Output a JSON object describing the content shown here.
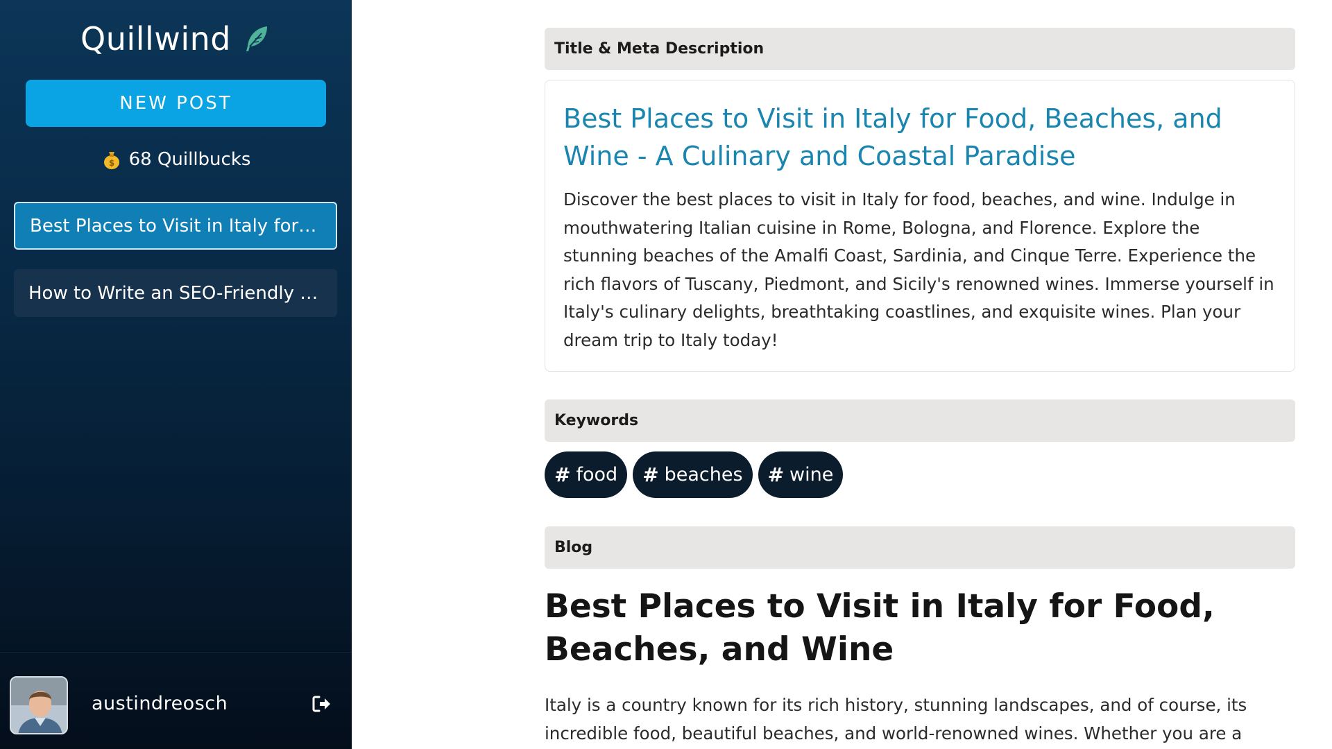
{
  "sidebar": {
    "brand": "Quillwind",
    "brand_icon": "feather-icon",
    "new_post_label": "NEW POST",
    "credits_icon": "money-bag-icon",
    "credits": "68 Quillbucks",
    "posts": [
      {
        "label": "Best Places to Visit in Italy for Fo...",
        "active": true
      },
      {
        "label": "How to Write an SEO-Friendly Bl...",
        "active": false
      }
    ],
    "user": {
      "username": "austindreosch",
      "avatar": "user-avatar",
      "logout_icon": "logout-icon"
    }
  },
  "main": {
    "title_section_label": "Title & Meta Description",
    "meta_title": "Best Places to Visit in Italy for Food, Beaches, and Wine - A Culinary and Coastal Paradise",
    "meta_description": "Discover the best places to visit in Italy for food, beaches, and wine. Indulge in mouthwatering Italian cuisine in Rome, Bologna, and Florence. Explore the stunning beaches of the Amalfi Coast, Sardinia, and Cinque Terre. Experience the rich flavors of Tuscany, Piedmont, and Sicily's renowned wines. Immerse yourself in Italy's culinary delights, breathtaking coastlines, and exquisite wines. Plan your dream trip to Italy today!",
    "keywords_section_label": "Keywords",
    "keyword_prefix": "#",
    "keywords": [
      "food",
      "beaches",
      "wine"
    ],
    "blog_section_label": "Blog",
    "blog_title": "Best Places to Visit in Italy for Food, Beaches, and Wine",
    "blog_intro": "Italy is a country known for its rich history, stunning landscapes, and of course, its incredible food, beautiful beaches, and world-renowned wines. Whether you are a"
  },
  "colors": {
    "sidebar_top": "#0c3557",
    "sidebar_bottom": "#040e1b",
    "accent": "#0aa3e3",
    "active_post": "#0f7fb5",
    "meta_title": "#1a86b0",
    "chip_bg": "#0b1d2d",
    "section_header_bg": "#e8e6e4"
  }
}
